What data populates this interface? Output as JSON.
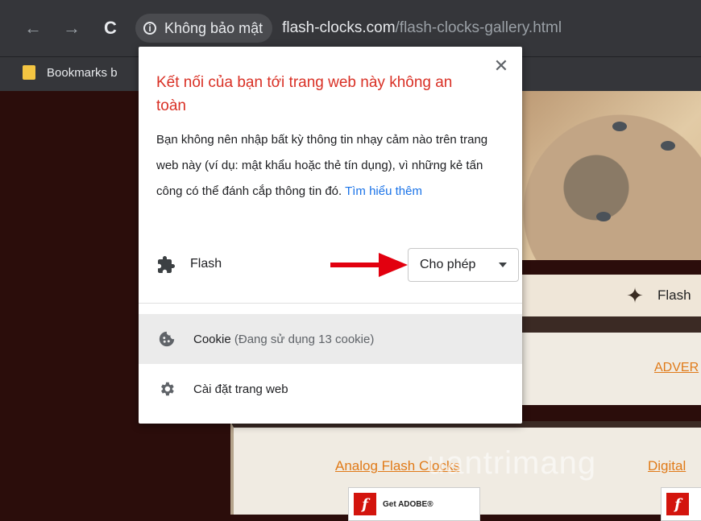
{
  "browser": {
    "nav": {
      "back_glyph": "←",
      "forward_glyph": "→",
      "reload_glyph": "C"
    },
    "omnibox": {
      "security_label": "Không bảo mật",
      "url_host": "flash-clocks.com",
      "url_path": "/flash-clocks-gallery.html"
    },
    "bookmarks": [
      {
        "label": "Bookmarks b"
      }
    ]
  },
  "popup": {
    "title": "Kết nối của bạn tới trang web này không an toàn",
    "body": "Bạn không nên nhập bất kỳ thông tin nhạy cảm nào trên trang web này (ví dụ: mật khẩu hoặc thẻ tín dụng), vì những kẻ tấn công có thể đánh cắp thông tin đó.",
    "learn_more": "Tìm hiểu thêm",
    "flash": {
      "label": "Flash",
      "selected": "Cho phép"
    },
    "cookie": {
      "label": "Cookie",
      "detail": "(Đang sử dụng 13 cookie)"
    },
    "site_settings": "Cài đặt trang web"
  },
  "page": {
    "nav_flash": "Flash",
    "adver_link": "ADVER",
    "gallery_links": [
      "Analog Flash Clocks",
      "Digital"
    ],
    "adobe_badge": "Get ADOBE®",
    "watermark": "uantrimang"
  },
  "colors": {
    "warning_red": "#d93025",
    "link_blue": "#1a73e8",
    "arrow_red": "#e2000f",
    "site_orange": "#e07a18"
  },
  "icons": {
    "info": "info-icon",
    "close": "close-icon",
    "flash": "puzzle-icon",
    "cookie": "cookie-icon",
    "settings": "gear-icon"
  }
}
